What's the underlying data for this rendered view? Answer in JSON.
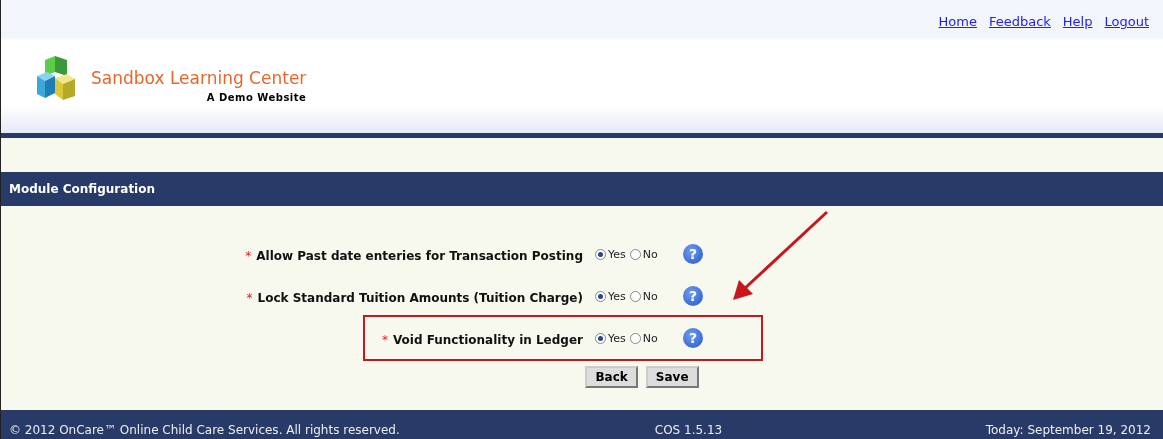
{
  "header": {
    "nav_links": [
      "Home",
      "Feedback",
      "Help",
      "Logout"
    ],
    "logo": {
      "title": "Sandbox Learning Center",
      "subtitle": "A Demo Website"
    }
  },
  "section_title": "Module Configuration",
  "settings": [
    {
      "mark": "*",
      "label": "Allow Past date enteries for Transaction Posting",
      "options": [
        {
          "label": "Yes",
          "selected": true
        },
        {
          "label": "No",
          "selected": false
        }
      ],
      "help": "?",
      "highlighted": false
    },
    {
      "mark": "*",
      "label": "Lock Standard Tuition Amounts (Tuition Charge)",
      "options": [
        {
          "label": "Yes",
          "selected": true
        },
        {
          "label": "No",
          "selected": false
        }
      ],
      "help": "?",
      "highlighted": false
    },
    {
      "mark": "*",
      "label": "Void Functionality in Ledger",
      "options": [
        {
          "label": "Yes",
          "selected": true
        },
        {
          "label": "No",
          "selected": false
        }
      ],
      "help": "?",
      "highlighted": true
    }
  ],
  "buttons": [
    "Back",
    "Save"
  ],
  "footer": {
    "copyright": "© 2012 OnCare™ Online Child Care Services. All rights reserved.",
    "version": "COS 1.5.13",
    "date": "Today: September 19, 2012"
  }
}
